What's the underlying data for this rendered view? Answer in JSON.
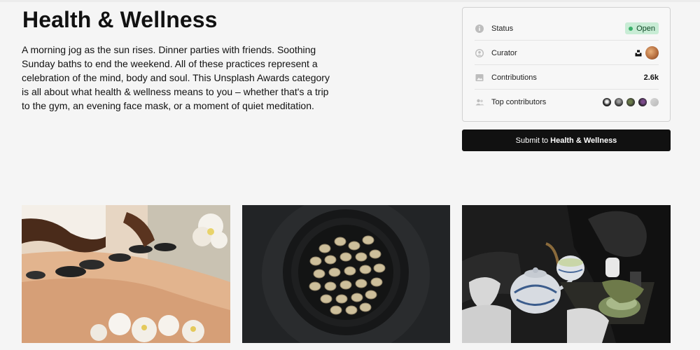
{
  "collection": {
    "title": "Health & Wellness",
    "description": "A morning jog as the sun rises. Dinner parties with friends. Soothing Sunday baths to end the weekend. All of these practices represent a celebration of the mind, body and soul. This Unsplash Awards category is all about what health & wellness means to you – whether that's a trip to the gym, an evening face mask, or a moment of quiet meditation."
  },
  "info_card": {
    "status": {
      "label": "Status",
      "value": "Open",
      "icon": "info-icon"
    },
    "curator": {
      "label": "Curator",
      "icon": "user-circle-icon"
    },
    "contributions": {
      "label": "Contributions",
      "value": "2.6k",
      "icon": "image-icon"
    },
    "top_contributors": {
      "label": "Top contributors",
      "icon": "users-icon"
    }
  },
  "submit": {
    "prefix": "Submit to",
    "target": "Health & Wellness"
  },
  "colors": {
    "accent_dark": "#111111",
    "status_open_bg": "#c8ecd5",
    "status_open_dot": "#3cb06a"
  }
}
